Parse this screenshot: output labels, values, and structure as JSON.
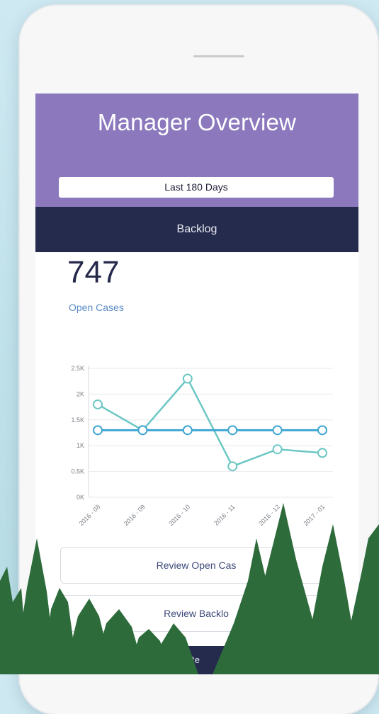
{
  "app": {
    "title": "Manager Overview",
    "range_label": "Last 180 Days",
    "tab_label": "Backlog"
  },
  "metric": {
    "value": "747",
    "label": "Open Cases"
  },
  "chart_data": {
    "type": "line",
    "x": [
      "2016 - 08",
      "2016 - 09",
      "2016 - 10",
      "2016 - 11",
      "2016 - 12",
      "2017 - 01"
    ],
    "ytick_labels": [
      "0K",
      "0.5K",
      "1K",
      "1.5K",
      "2K",
      "2.5K"
    ],
    "ytick_values": [
      0,
      500,
      1000,
      1500,
      2000,
      2500
    ],
    "ylim": [
      0,
      2500
    ],
    "grid": true,
    "series": [
      {
        "color": "#6cc7c4",
        "values": [
          1800,
          1300,
          2300,
          600,
          930,
          860
        ]
      },
      {
        "color": "#3fa6d3",
        "values": [
          1300,
          1300,
          1300,
          1300,
          1300,
          1300
        ]
      }
    ]
  },
  "actions": {
    "review_open": "Review Open Cas",
    "review_backlog": "Review Backlo"
  },
  "bottom_nav_label": "t Re"
}
